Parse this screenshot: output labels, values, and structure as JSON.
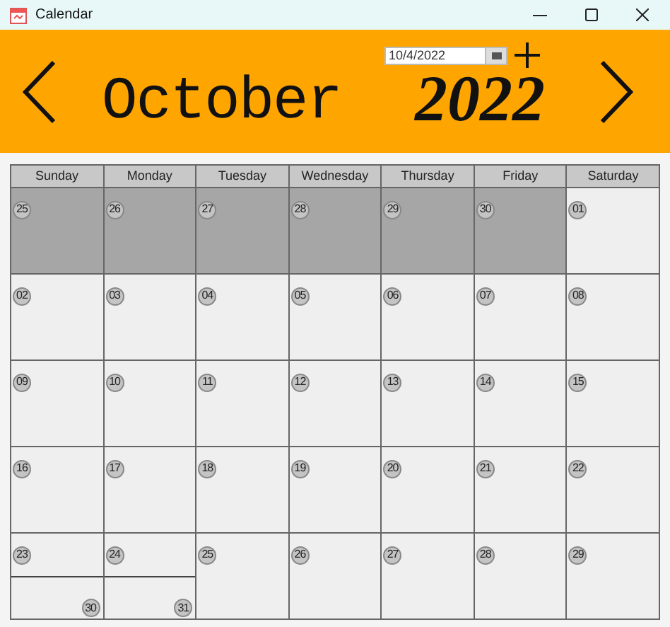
{
  "window": {
    "title": "Calendar"
  },
  "header": {
    "month": "October",
    "year": "2022",
    "date_field": {
      "value": "10/4/2022"
    }
  },
  "weekdays": [
    "Sunday",
    "Monday",
    "Tuesday",
    "Wednesday",
    "Thursday",
    "Friday",
    "Saturday"
  ],
  "weeks": [
    [
      {
        "kind": "single",
        "day": "25",
        "outside": true
      },
      {
        "kind": "single",
        "day": "26",
        "outside": true
      },
      {
        "kind": "single",
        "day": "27",
        "outside": true
      },
      {
        "kind": "single",
        "day": "28",
        "outside": true
      },
      {
        "kind": "single",
        "day": "29",
        "outside": true
      },
      {
        "kind": "single",
        "day": "30",
        "outside": true
      },
      {
        "kind": "single",
        "day": "01",
        "outside": false
      }
    ],
    [
      {
        "kind": "single",
        "day": "02",
        "outside": false
      },
      {
        "kind": "single",
        "day": "03",
        "outside": false
      },
      {
        "kind": "single",
        "day": "04",
        "outside": false
      },
      {
        "kind": "single",
        "day": "05",
        "outside": false
      },
      {
        "kind": "single",
        "day": "06",
        "outside": false
      },
      {
        "kind": "single",
        "day": "07",
        "outside": false
      },
      {
        "kind": "single",
        "day": "08",
        "outside": false
      }
    ],
    [
      {
        "kind": "single",
        "day": "09",
        "outside": false
      },
      {
        "kind": "single",
        "day": "10",
        "outside": false
      },
      {
        "kind": "single",
        "day": "11",
        "outside": false
      },
      {
        "kind": "single",
        "day": "12",
        "outside": false
      },
      {
        "kind": "single",
        "day": "13",
        "outside": false
      },
      {
        "kind": "single",
        "day": "14",
        "outside": false
      },
      {
        "kind": "single",
        "day": "15",
        "outside": false
      }
    ],
    [
      {
        "kind": "single",
        "day": "16",
        "outside": false
      },
      {
        "kind": "single",
        "day": "17",
        "outside": false
      },
      {
        "kind": "single",
        "day": "18",
        "outside": false
      },
      {
        "kind": "single",
        "day": "19",
        "outside": false
      },
      {
        "kind": "single",
        "day": "20",
        "outside": false
      },
      {
        "kind": "single",
        "day": "21",
        "outside": false
      },
      {
        "kind": "single",
        "day": "22",
        "outside": false
      }
    ],
    [
      {
        "kind": "split",
        "day": "23",
        "second_day": "30",
        "outside": false
      },
      {
        "kind": "split",
        "day": "24",
        "second_day": "31",
        "outside": false
      },
      {
        "kind": "single",
        "day": "25",
        "outside": false
      },
      {
        "kind": "single",
        "day": "26",
        "outside": false
      },
      {
        "kind": "single",
        "day": "27",
        "outside": false
      },
      {
        "kind": "single",
        "day": "28",
        "outside": false
      },
      {
        "kind": "single",
        "day": "29",
        "outside": false
      }
    ]
  ]
}
